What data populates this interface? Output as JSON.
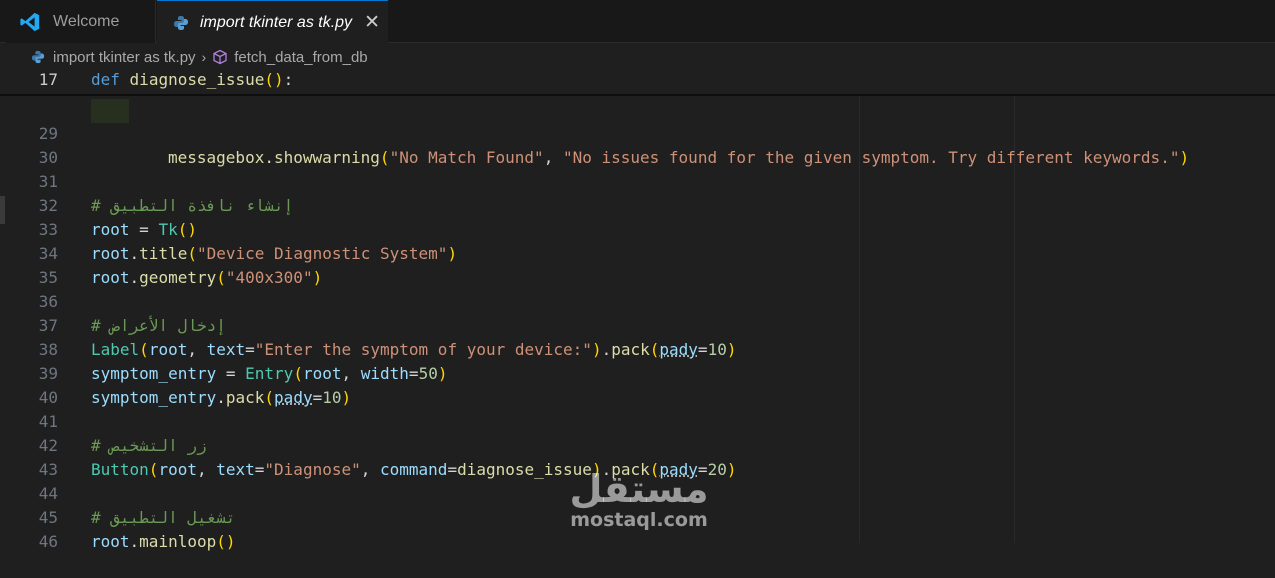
{
  "tabs": [
    {
      "label": "Welcome",
      "icon": "vscode-icon",
      "active": false
    },
    {
      "label": "import tkinter as tk.py",
      "icon": "python-icon",
      "active": true
    }
  ],
  "breadcrumb": {
    "file": "import tkinter as tk.py",
    "symbol": "fetch_data_from_db"
  },
  "watermark": {
    "text": "مستقل",
    "domain": "mostaql.com"
  },
  "sticky": {
    "ln": "17",
    "kw": "def",
    "name": "diagnose_issue",
    "paren": "()",
    "colon": ":"
  },
  "lines": {
    "l29": {
      "ln": "29",
      "fn": "messagebox.showwarning",
      "o": "(",
      "s1": "\"No Match Found\"",
      "c": ", ",
      "s2": "\"No issues found for the given symptom. Try different keywords.\"",
      "cl": ")"
    },
    "l30": {
      "ln": "30"
    },
    "l31": {
      "ln": "31",
      "cm": "# إنشاء نافذة التطبيق"
    },
    "l32": {
      "ln": "32",
      "v": "root",
      "eq": " = ",
      "cls": "Tk",
      "p": "()"
    },
    "l33": {
      "ln": "33",
      "v": "root",
      "d": ".",
      "fn": "title",
      "o": "(",
      "s": "\"Device Diagnostic System\"",
      "cl": ")"
    },
    "l34": {
      "ln": "34",
      "v": "root",
      "d": ".",
      "fn": "geometry",
      "o": "(",
      "s": "\"400x300\"",
      "cl": ")"
    },
    "l35": {
      "ln": "35"
    },
    "l36": {
      "ln": "36",
      "cm": "# إدخال الأعراض"
    },
    "l37": {
      "ln": "37",
      "cls": "Label",
      "o": "(",
      "a1": "root",
      "c1": ", ",
      "k": "text",
      "eq": "=",
      "s": "\"Enter the symptom of your device:\"",
      "cl": ")",
      "d": ".",
      "fn": "pack",
      "o2": "(",
      "k2": "pady",
      "eq2": "=",
      "n": "10",
      "cl2": ")"
    },
    "l38": {
      "ln": "38",
      "v": "symptom_entry",
      "eq": " = ",
      "cls": "Entry",
      "o": "(",
      "a1": "root",
      "c1": ", ",
      "k": "width",
      "eq2": "=",
      "n": "50",
      "cl": ")"
    },
    "l39": {
      "ln": "39",
      "v": "symptom_entry",
      "d": ".",
      "fn": "pack",
      "o": "(",
      "k": "pady",
      "eq": "=",
      "n": "10",
      "cl": ")"
    },
    "l40": {
      "ln": "40"
    },
    "l41": {
      "ln": "41",
      "cm": "# زر التشخيص"
    },
    "l42": {
      "ln": "42",
      "cls": "Button",
      "o": "(",
      "a1": "root",
      "c1": ", ",
      "k": "text",
      "eq": "=",
      "s": "\"Diagnose\"",
      "c2": ", ",
      "k2": "command",
      "eq2": "=",
      "a2": "diagnose_issue",
      "cl": ")",
      "d": ".",
      "fn": "pack",
      "o2": "(",
      "k3": "pady",
      "eq3": "=",
      "n": "20",
      "cl2": ")"
    },
    "l43": {
      "ln": "43"
    },
    "l44": {
      "ln": "44",
      "cm": "# تشغيل التطبيق"
    },
    "l45": {
      "ln": "45",
      "v": "root",
      "d": ".",
      "fn": "mainloop",
      "p": "()"
    },
    "l46": {
      "ln": "46"
    }
  },
  "colors": {
    "keyword": "#569cd6",
    "function": "#dcdcaa",
    "string": "#ce9178",
    "comment": "#6a9955",
    "class": "#4ec9b0",
    "number": "#b5cea8",
    "accent": "#0078d4"
  }
}
